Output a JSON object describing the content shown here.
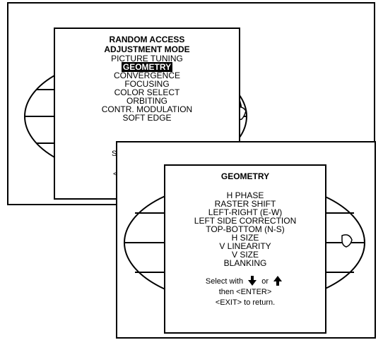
{
  "back_screen": {
    "menu_title_line1": "RANDOM ACCESS",
    "menu_title_line2": "ADJUSTMENT MODE",
    "items": [
      "PICTURE TUNING",
      "GEOMETRY",
      "CONVERGENCE",
      "FOCUSING",
      "COLOR SELECT",
      "ORBITING",
      "CONTR. MODULATION",
      "SOFT EDGE"
    ],
    "selected_item": "GEOMETRY",
    "partial_footer_1": "S",
    "partial_footer_2": "<"
  },
  "front_screen": {
    "menu_title": "GEOMETRY",
    "items": [
      "H PHASE",
      "RASTER SHIFT",
      "LEFT-RIGHT (E-W)",
      "LEFT SIDE CORRECTION",
      "TOP-BOTTOM (N-S)",
      "H SIZE",
      "V LINEARITY",
      "V SIZE",
      "BLANKING"
    ],
    "select_prefix": "Select with",
    "select_or": "or",
    "enter_text": "then <ENTER>",
    "exit_text": "<EXIT> to return."
  },
  "icons": [
    "globe-icon",
    "down-arrow-icon",
    "up-arrow-icon"
  ],
  "colors": {
    "background": "#ffffff",
    "ink": "#000000",
    "highlight_bg": "#000000",
    "highlight_fg": "#ffffff"
  }
}
